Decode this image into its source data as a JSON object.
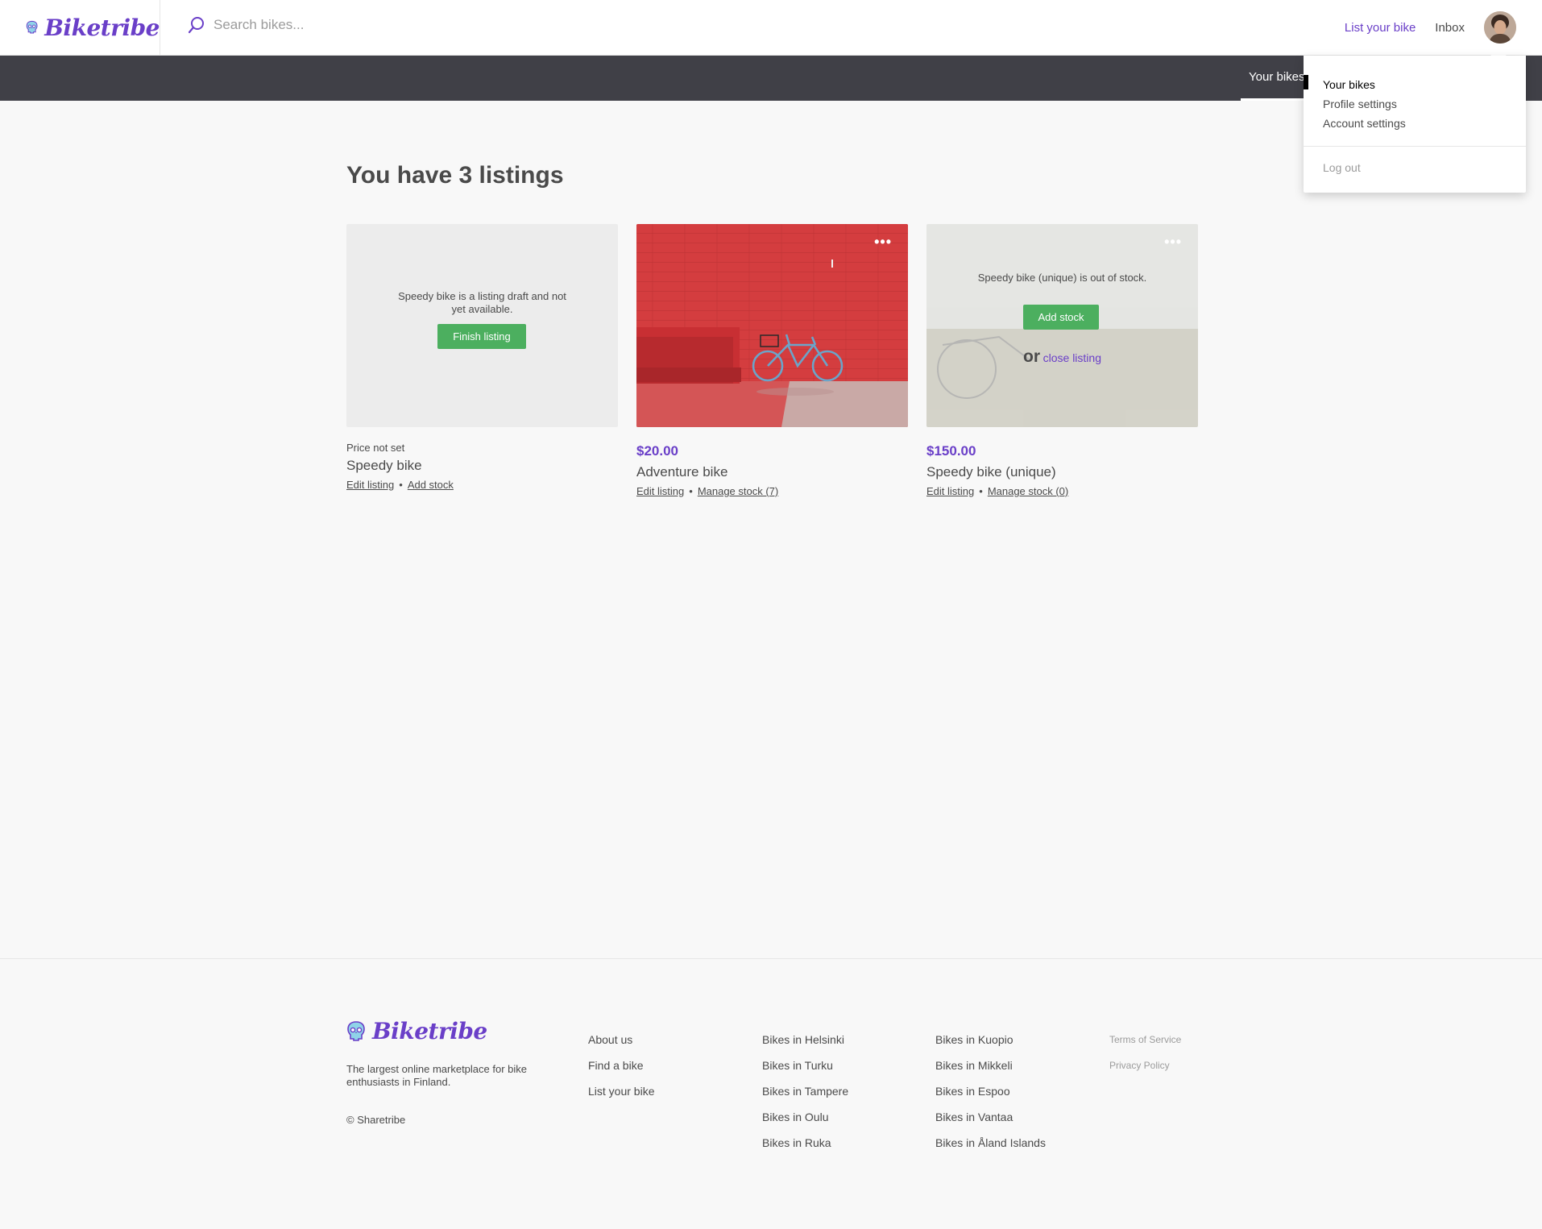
{
  "brand": {
    "name": "Biketribe"
  },
  "header": {
    "search_placeholder": "Search bikes...",
    "list_bike": "List your bike",
    "inbox": "Inbox"
  },
  "subnav": {
    "active_tab": "Your bikes"
  },
  "dropdown": {
    "items": [
      "Your bikes",
      "Profile settings",
      "Account settings"
    ],
    "logout": "Log out"
  },
  "main": {
    "heading": "You have 3 listings",
    "listings": [
      {
        "overlay_text": "Speedy bike is a listing draft and not yet available.",
        "button": "Finish listing",
        "price": "Price not set",
        "title": "Speedy bike",
        "action1": "Edit listing",
        "action2": "Add stock"
      },
      {
        "price": "$20.00",
        "title": "Adventure bike",
        "action1": "Edit listing",
        "action2": "Manage stock (7)"
      },
      {
        "overlay_text": "Speedy bike (unique) is out of stock.",
        "button": "Add stock",
        "or": "or",
        "close_link": "close listing",
        "price": "$150.00",
        "title": "Speedy bike (unique)",
        "action1": "Edit listing",
        "action2": "Manage stock (0)"
      }
    ]
  },
  "footer": {
    "tagline": "The largest online marketplace for bike enthusiasts in Finland.",
    "copyright": "© Sharetribe",
    "col1": [
      "About us",
      "Find a bike",
      "List your bike"
    ],
    "col2": [
      "Bikes in Helsinki",
      "Bikes in Turku",
      "Bikes in Tampere",
      "Bikes in Oulu",
      "Bikes in Ruka"
    ],
    "col3": [
      "Bikes in Kuopio",
      "Bikes in Mikkeli",
      "Bikes in Espoo",
      "Bikes in Vantaa",
      "Bikes in Åland Islands"
    ],
    "legal": [
      "Terms of Service",
      "Privacy Policy"
    ]
  },
  "colors": {
    "brand": "#6a3fc8",
    "dark_nav": "#404047",
    "success": "#4caf5f",
    "text": "#4a4a4a"
  },
  "icons": [
    "bike-skull-logo-icon",
    "search-icon",
    "more-dots-icon"
  ]
}
